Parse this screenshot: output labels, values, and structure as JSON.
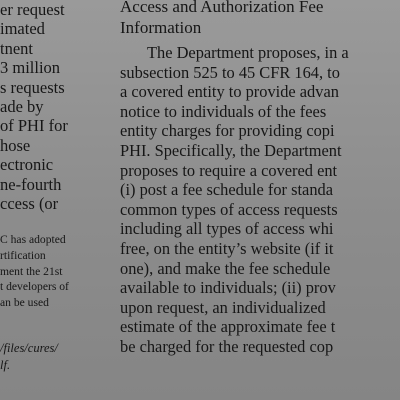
{
  "left_column": {
    "main_lines": [
      "er request",
      "imated",
      "tnent",
      "3 million",
      "s requests",
      "ade by",
      "of PHI for",
      "hose",
      "ectronic",
      "ne-fourth",
      "ccess (or"
    ],
    "footnote_lines": [
      "C has adopted",
      "rtification",
      "ment the 21st",
      "t developers of",
      "an be used"
    ],
    "url_lines": [
      "/files/cures/",
      "lf."
    ]
  },
  "right_column": {
    "heading_lines": [
      "Access and Authorization Fee",
      "Information"
    ],
    "body_lines": [
      "The Department proposes, in a",
      "subsection 525 to 45 CFR 164, to",
      "a covered entity to provide advan",
      "notice to individuals of the fees",
      "entity charges for providing copi",
      "PHI. Specifically, the Department",
      "proposes to require a covered ent",
      "(i) post a fee schedule for standa",
      "common types of access requests",
      "including all types of access whi",
      "free, on the entity’s website (if it",
      "one), and make the fee schedule",
      "available to individuals; (ii) prov",
      "upon request, an individualized",
      "estimate of the approximate fee t",
      "be charged for the requested cop"
    ]
  }
}
